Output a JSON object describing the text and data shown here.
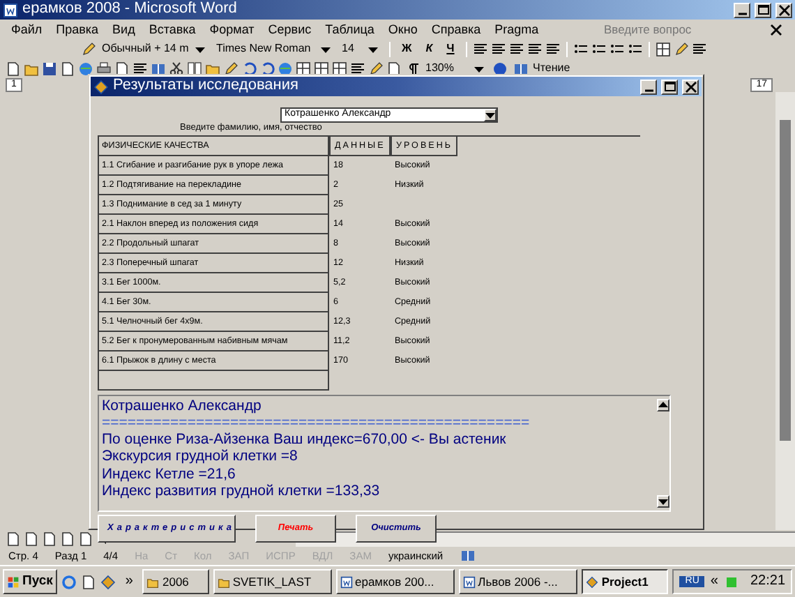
{
  "window": {
    "title": "ерамков 2008 - Microsoft Word"
  },
  "menu": [
    "Файл",
    "Правка",
    "Вид",
    "Вставка",
    "Формат",
    "Сервис",
    "Таблица",
    "Окно",
    "Справка",
    "Pragma"
  ],
  "help": {
    "placeholder": "Введите вопрос"
  },
  "format_toolbar": {
    "style": "Обычный + 14 m",
    "font": "Times New Roman",
    "size": "14",
    "bold": "Ж",
    "italic": "К",
    "underline": "Ч"
  },
  "standard_toolbar": {
    "zoom": "130%",
    "reading": "Чтение"
  },
  "ruler": [
    "1",
    "17"
  ],
  "dialog": {
    "title": "Результаты исследования",
    "name_select": {
      "value": "Котрашенко Александр",
      "label": "Введите фамилию, имя, отчество"
    },
    "table": {
      "columns": [
        "ФИЗИЧЕСКИЕ КАЧЕСТВА",
        "ДАННЫЕ",
        "УРОВЕНЬ"
      ],
      "rows": [
        {
          "quality": "1.1  Сгибание и разгибание рук в упоре лежа",
          "value": "18",
          "level": "Высокий"
        },
        {
          "quality": "1.2  Подтягивание на перекладине",
          "value": "2",
          "level": "Низкий"
        },
        {
          "quality": "1.3  Поднимание в сед за 1 минуту",
          "value": "25"
        },
        {
          "quality": "2.1  Наклон вперед из положения сидя",
          "value": "14",
          "level": "Высокий"
        },
        {
          "quality": "2.2  Продольный шпагат",
          "value": "8",
          "level": "Высокий"
        },
        {
          "quality": "2.3  Поперечный шпагат",
          "value": "12",
          "level": "Низкий"
        },
        {
          "quality": "3.1 Бег 1000м.",
          "value": "5,2",
          "level": "Высокий"
        },
        {
          "quality": "4.1 Бег 30м.",
          "value": "6",
          "level": "Средний"
        },
        {
          "quality": "5.1  Челночный бег 4х9м.",
          "value": "12,3",
          "level": "Средний"
        },
        {
          "quality": "5.2  Бег к пронумерованным набивным мячам",
          "value": "11,2",
          "level": "Высокий"
        },
        {
          "quality": "6.1  Прыжок в длину с места",
          "value": "170",
          "level": "Высокий"
        }
      ]
    },
    "memo": {
      "lines": [
        "Котрашенко Александр",
        "==================================================",
        "По оценке Риза-Айзенка Ваш индекс=670,00 <- Вы астеник",
        "Экскурсия грудной клетки =8",
        "Индекс Кетле =21,6",
        "Индекс развития грудной клетки =133,33"
      ]
    },
    "buttons": [
      {
        "label": "Характеристика",
        "color": "#000080"
      },
      {
        "label": "Печать",
        "color": "#ff0000"
      },
      {
        "label": "Очистить",
        "color": "#000080"
      }
    ]
  },
  "status_bar": [
    {
      "text": "Стр. 4",
      "disabled": false
    },
    {
      "text": "Разд 1",
      "disabled": false
    },
    {
      "text": "4/4",
      "disabled": false
    },
    {
      "text": "На",
      "disabled": true
    },
    {
      "text": "Ст",
      "disabled": true
    },
    {
      "text": "Кол",
      "disabled": true
    },
    {
      "text": "ЗАП",
      "disabled": true
    },
    {
      "text": "ИСПР",
      "disabled": true
    },
    {
      "text": "ВДЛ",
      "disabled": true
    },
    {
      "text": "ЗАМ",
      "disabled": true
    },
    {
      "text": "украинский",
      "disabled": false
    }
  ],
  "taskbar": {
    "start": "Пуск",
    "more": "»",
    "tasks": [
      {
        "label": "2006",
        "kind": "folder",
        "selected": false
      },
      {
        "label": "SVETIK_LAST",
        "kind": "folder",
        "selected": false
      },
      {
        "label": "ерамков 200...",
        "kind": "word",
        "selected": false
      },
      {
        "label": "Львов 2006 -...",
        "kind": "word",
        "selected": false
      },
      {
        "label": "Project1",
        "kind": "app",
        "selected": true
      }
    ],
    "language": "RU",
    "tray_toggle": "«",
    "clock": "22:21"
  }
}
